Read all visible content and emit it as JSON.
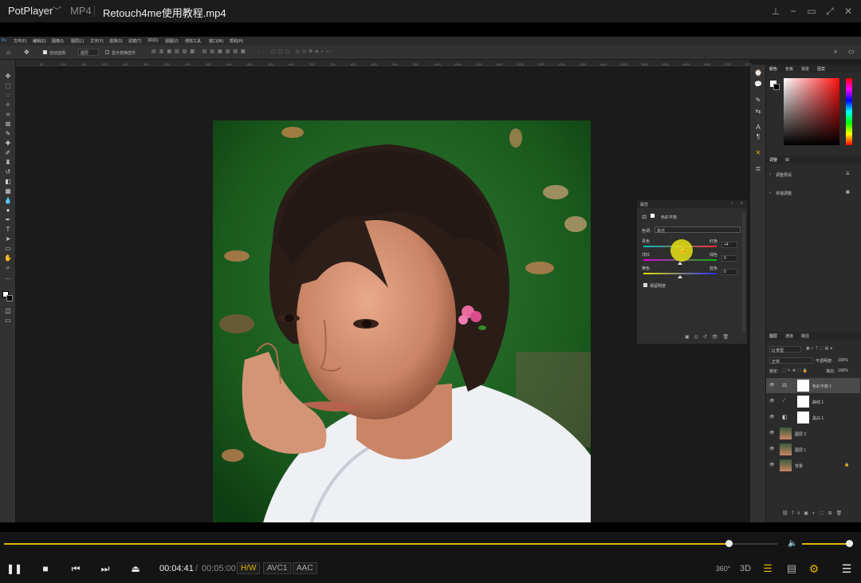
{
  "player": {
    "brand": "PotPlayer",
    "format": "MP4",
    "filename": "Retouch4me使用教程.mp4",
    "window_buttons": [
      "pin-icon",
      "minimize-icon",
      "maximize-icon",
      "fullscreen-icon",
      "close-icon"
    ],
    "time_current": "00:04:41",
    "time_separator": "/",
    "time_total": "00:05:00",
    "tag_hw": "H/W",
    "tag_video": "AVC1",
    "tag_audio": "AAC",
    "icon_360": "360°",
    "icon_3d": "3D",
    "progress_fraction": 0.937,
    "volume_fraction": 1.0,
    "accent_color": "#e0b400"
  },
  "photoshop": {
    "menu": [
      "文件(F)",
      "编辑(E)",
      "图像(I)",
      "图层(L)",
      "文字(Y)",
      "选择(S)",
      "滤镜(T)",
      "3D(D)",
      "视图(V)",
      "增效工具",
      "窗口(W)",
      "帮助(H)"
    ],
    "options": {
      "auto_select_label": "自动选择:",
      "auto_select_value": "图层",
      "show_transform_label": "显示变换控件"
    },
    "ruler_ticks": [
      "50",
      "100",
      "150",
      "200",
      "250",
      "300",
      "350",
      "400",
      "450",
      "500",
      "550",
      "600",
      "650",
      "700",
      "750",
      "800",
      "850",
      "900",
      "950",
      "1000",
      "1050",
      "1100",
      "1150",
      "1200",
      "1250",
      "1300",
      "1350",
      "1400",
      "1450",
      "1500",
      "1550",
      "1600",
      "1650",
      "1700",
      "1750"
    ],
    "properties": {
      "tab": "属性",
      "title": "色彩平衡",
      "tone_label": "色调:",
      "tone_value": "高光",
      "sliders": [
        {
          "left": "青色",
          "right": "红色",
          "value": "+4"
        },
        {
          "left": "洋红",
          "right": "绿色",
          "value": "0"
        },
        {
          "left": "黄色",
          "right": "蓝色",
          "value": "0"
        }
      ],
      "preserve_label": "保留明度"
    },
    "color_panel_tabs": [
      "颜色",
      "色板",
      "渐变",
      "图案"
    ],
    "adjust_panel_tabs": [
      "调整",
      "库"
    ],
    "adjust_items": [
      "调整预设",
      "单独调整"
    ],
    "layers_panel": {
      "tabs": [
        "图层",
        "通道",
        "路径"
      ],
      "filter_label": "Q 类型",
      "blend_mode": "正常",
      "opacity_label": "不透明度:",
      "opacity_value": "100%",
      "lock_label": "锁定:",
      "fill_label": "填充:",
      "fill_value": "100%",
      "layers": [
        {
          "name": "色彩平衡 1",
          "selected": true
        },
        {
          "name": "曲线 1",
          "selected": false
        },
        {
          "name": "黑白 1",
          "selected": false
        },
        {
          "name": "图层 2",
          "selected": false
        },
        {
          "name": "图层 1",
          "selected": false
        },
        {
          "name": "背景",
          "selected": false
        }
      ]
    }
  }
}
